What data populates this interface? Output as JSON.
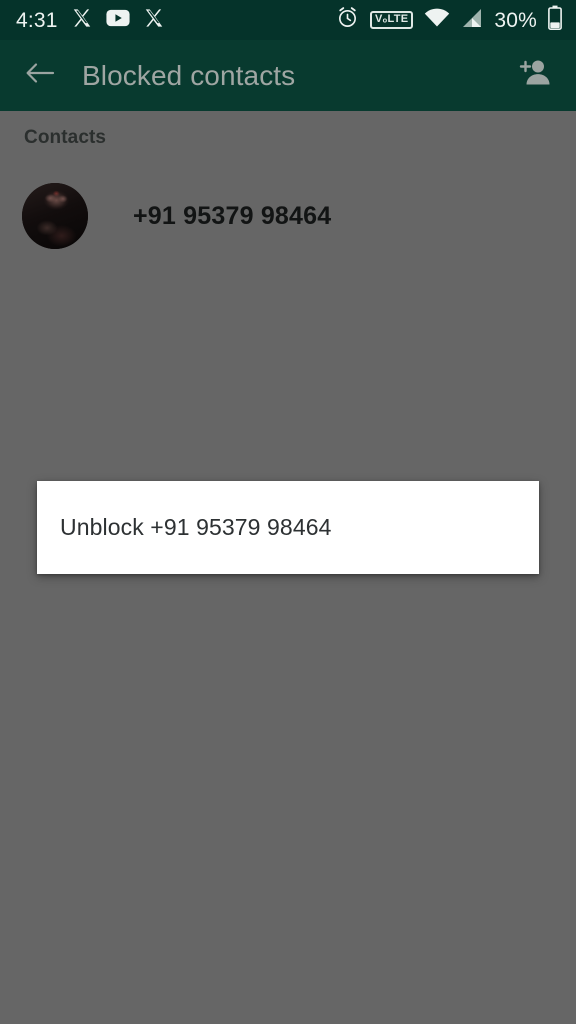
{
  "status_bar": {
    "time": "4:31",
    "left_icons": [
      "x-twitter-icon",
      "youtube-icon",
      "x-twitter-icon"
    ],
    "alarm_icon": "alarm-clock-icon",
    "volte_label": "VₒLTE",
    "wifi_icon": "wifi-icon",
    "signal_icon": "cellular-signal-icon",
    "battery_percent": "30%",
    "battery_icon": "battery-icon",
    "background_color": "#05332a"
  },
  "app_bar": {
    "back_icon": "back-arrow-icon",
    "title": "Blocked contacts",
    "add_contact_icon": "add-person-icon",
    "background_color": "#083a2f",
    "title_color": "#9fa6a3"
  },
  "content": {
    "scrim_color": "#666666",
    "section_header": "Contacts",
    "contacts": [
      {
        "avatar": "contact-avatar-photo",
        "name": "+91 95379 98464"
      }
    ]
  },
  "popup_menu": {
    "items": [
      {
        "label": "Unblock +91 95379 98464"
      }
    ],
    "background_color": "#ffffff",
    "text_color": "#2d3133"
  }
}
